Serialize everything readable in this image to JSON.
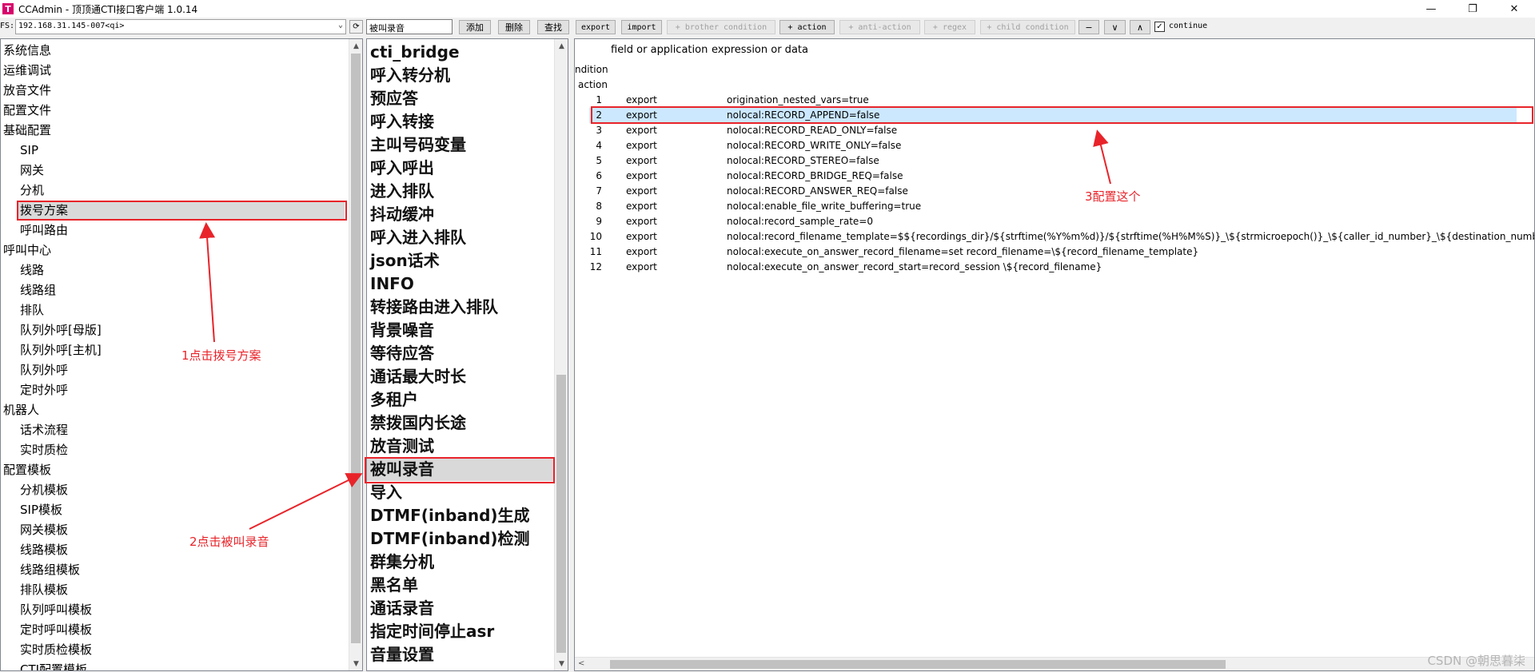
{
  "window": {
    "icon_glyph": "T",
    "title": "CCAdmin - 顶顶通CTI接口客户端 1.0.14",
    "minimize_glyph": "—",
    "restore_glyph": "❐",
    "close_glyph": "✕"
  },
  "toolbar": {
    "fs_label": "FS:",
    "fs_value": "192.168.31.145-007<qi>",
    "fs_arrow": "⌄",
    "refresh_glyph": "⟳",
    "search_value": "被叫录音",
    "add_label": "添加",
    "delete_label": "删除",
    "find_label": "查找",
    "export_label": "export",
    "import_label": "import",
    "brother_condition_label": "+ brother condition",
    "action_label": "+ action",
    "anti_action_label": "+ anti-action",
    "regex_label": "+ regex",
    "child_condition_label": "+ child condition",
    "minus_label": "−",
    "down_label": "∨",
    "up_label": "∧",
    "continue_checked": "✓",
    "continue_label": "continue"
  },
  "left_tree": {
    "items": [
      {
        "label": "系统信息",
        "level": 0
      },
      {
        "label": "运维调试",
        "level": 0
      },
      {
        "label": "放音文件",
        "level": 0
      },
      {
        "label": "配置文件",
        "level": 0
      },
      {
        "label": "基础配置",
        "level": 0
      },
      {
        "label": "SIP",
        "level": 1
      },
      {
        "label": "网关",
        "level": 1
      },
      {
        "label": "分机",
        "level": 1
      },
      {
        "label": "拨号方案",
        "level": 1,
        "selected": true
      },
      {
        "label": "呼叫路由",
        "level": 1
      },
      {
        "label": "呼叫中心",
        "level": 0
      },
      {
        "label": "线路",
        "level": 1
      },
      {
        "label": "线路组",
        "level": 1
      },
      {
        "label": "排队",
        "level": 1
      },
      {
        "label": "队列外呼[母版]",
        "level": 1
      },
      {
        "label": "队列外呼[主机]",
        "level": 1
      },
      {
        "label": "队列外呼",
        "level": 1
      },
      {
        "label": "定时外呼",
        "level": 1
      },
      {
        "label": "机器人",
        "level": 0
      },
      {
        "label": "话术流程",
        "level": 1
      },
      {
        "label": "实时质检",
        "level": 1
      },
      {
        "label": "配置模板",
        "level": 0
      },
      {
        "label": "分机模板",
        "level": 1
      },
      {
        "label": "SIP模板",
        "level": 1
      },
      {
        "label": "网关模板",
        "level": 1
      },
      {
        "label": "线路模板",
        "level": 1
      },
      {
        "label": "线路组模板",
        "level": 1
      },
      {
        "label": "排队模板",
        "level": 1
      },
      {
        "label": "队列呼叫模板",
        "level": 1
      },
      {
        "label": "定时呼叫模板",
        "level": 1
      },
      {
        "label": "实时质检模板",
        "level": 1
      },
      {
        "label": "CTI配置模板",
        "level": 1
      }
    ],
    "scroll_up": "▲",
    "scroll_down": "▼"
  },
  "dialplan_list": {
    "items": [
      {
        "label": "cti_bridge"
      },
      {
        "label": "呼入转分机"
      },
      {
        "label": "预应答"
      },
      {
        "label": "呼入转接"
      },
      {
        "label": "主叫号码变量"
      },
      {
        "label": "呼入呼出"
      },
      {
        "label": "进入排队"
      },
      {
        "label": "抖动缓冲"
      },
      {
        "label": "呼入进入排队"
      },
      {
        "label": "json话术"
      },
      {
        "label": "INFO"
      },
      {
        "label": "转接路由进入排队"
      },
      {
        "label": "背景噪音"
      },
      {
        "label": "等待应答"
      },
      {
        "label": "通话最大时长"
      },
      {
        "label": "多租户"
      },
      {
        "label": "禁拨国内长途"
      },
      {
        "label": "放音测试"
      },
      {
        "label": "被叫录音",
        "selected": true
      },
      {
        "label": "导入"
      },
      {
        "label": "DTMF(inband)生成"
      },
      {
        "label": "DTMF(inband)检测"
      },
      {
        "label": "群集分机"
      },
      {
        "label": "黑名单"
      },
      {
        "label": "通话录音"
      },
      {
        "label": "指定时间停止asr"
      },
      {
        "label": "音量设置"
      }
    ],
    "scroll_up": "▲",
    "scroll_down": "▼"
  },
  "grid": {
    "col_field": "field or application",
    "col_data": "expression or data",
    "condition_label": "ndition",
    "action_label": "action",
    "rows": [
      {
        "idx": "1",
        "field": "export",
        "data": "origination_nested_vars=true"
      },
      {
        "idx": "2",
        "field": "export",
        "data": "nolocal:RECORD_APPEND=false",
        "selected": true
      },
      {
        "idx": "3",
        "field": "export",
        "data": "nolocal:RECORD_READ_ONLY=false"
      },
      {
        "idx": "4",
        "field": "export",
        "data": "nolocal:RECORD_WRITE_ONLY=false"
      },
      {
        "idx": "5",
        "field": "export",
        "data": "nolocal:RECORD_STEREO=false"
      },
      {
        "idx": "6",
        "field": "export",
        "data": "nolocal:RECORD_BRIDGE_REQ=false"
      },
      {
        "idx": "7",
        "field": "export",
        "data": "nolocal:RECORD_ANSWER_REQ=false"
      },
      {
        "idx": "8",
        "field": "export",
        "data": "nolocal:enable_file_write_buffering=true"
      },
      {
        "idx": "9",
        "field": "export",
        "data": "nolocal:record_sample_rate=0"
      },
      {
        "idx": "10",
        "field": "export",
        "data": "nolocal:record_filename_template=$${recordings_dir}/${strftime(%Y%m%d)}/${strftime(%H%M%S)}_\\${strmicroepoch()}_\\${caller_id_number}_\\${destination_number}_\\${uuid}.wav"
      },
      {
        "idx": "11",
        "field": "export",
        "data": "nolocal:execute_on_answer_record_filename=set record_filename=\\${record_filename_template}"
      },
      {
        "idx": "12",
        "field": "export",
        "data": "nolocal:execute_on_answer_record_start=record_session \\${record_filename}"
      }
    ],
    "hscroll_left": "<"
  },
  "annotations": {
    "step1": "1点击拨号方案",
    "step2": "2点击被叫录音",
    "step3": "3配置这个",
    "color": "#e8242a"
  },
  "watermark": "CSDN @朝思暮柒"
}
